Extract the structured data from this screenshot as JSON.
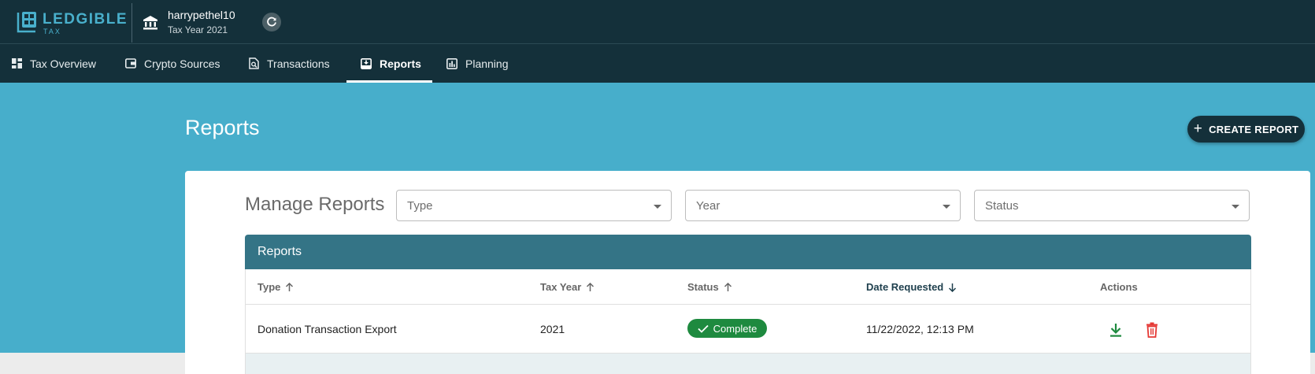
{
  "brand": {
    "name": "LEDGIBLE",
    "sub": "TAX"
  },
  "account": {
    "name": "harrypethel10",
    "tax_year": "Tax Year 2021"
  },
  "nav": {
    "items": [
      {
        "label": "Tax Overview",
        "icon": "dashboard-icon"
      },
      {
        "label": "Crypto Sources",
        "icon": "wallet-icon"
      },
      {
        "label": "Transactions",
        "icon": "document-search-icon"
      },
      {
        "label": "Reports",
        "icon": "inbox-download-icon",
        "active": true
      },
      {
        "label": "Planning",
        "icon": "bar-chart-icon"
      }
    ]
  },
  "page": {
    "title": "Reports",
    "create_label": "CREATE REPORT"
  },
  "filters": {
    "title": "Manage Reports",
    "type_placeholder": "Type",
    "year_placeholder": "Year",
    "status_placeholder": "Status"
  },
  "table": {
    "title": "Reports",
    "columns": [
      "Type",
      "Tax Year",
      "Status",
      "Date Requested",
      "Actions"
    ],
    "rows": [
      {
        "type": "Donation Transaction Export",
        "tax_year": "2021",
        "status": "Complete",
        "date": "11/22/2022, 12:13 PM"
      }
    ]
  },
  "colors": {
    "topbar": "#14303a",
    "hero": "#47aecb",
    "table_header": "#347486",
    "status_complete": "#1e8a3f",
    "download": "#1e8a3f",
    "delete": "#e53935"
  }
}
